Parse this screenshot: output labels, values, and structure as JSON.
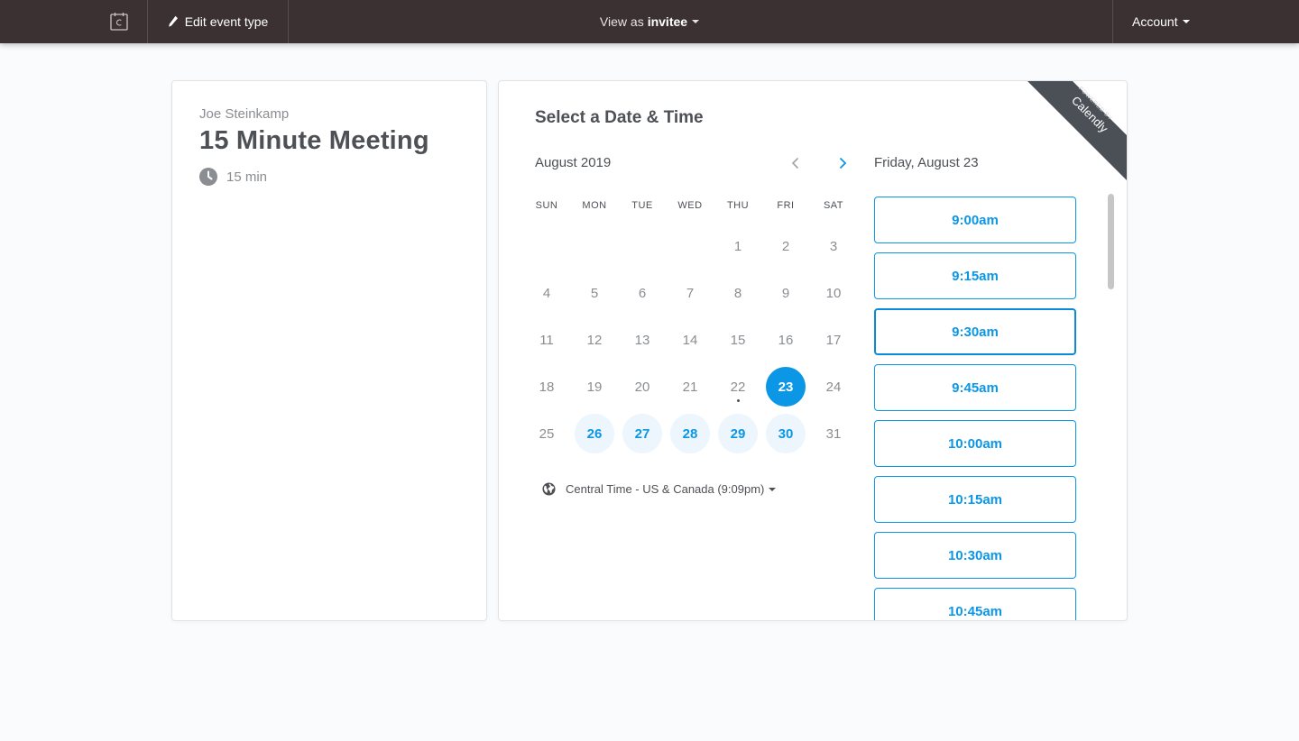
{
  "topbar": {
    "edit_label": "Edit event type",
    "view_prefix": "View as",
    "view_value": "invitee",
    "account_label": "Account",
    "bg_color": "#3b3032"
  },
  "event": {
    "host": "Joe Steinkamp",
    "title": "15 Minute Meeting",
    "duration": "15 min"
  },
  "scheduler": {
    "heading": "Select a Date & Time",
    "month": "August 2019",
    "weekdays": [
      "SUN",
      "MON",
      "TUE",
      "WED",
      "THU",
      "FRI",
      "SAT"
    ],
    "weeks": [
      [
        "",
        "",
        "",
        "",
        "1",
        "2",
        "3"
      ],
      [
        "4",
        "5",
        "6",
        "7",
        "8",
        "9",
        "10"
      ],
      [
        "11",
        "12",
        "13",
        "14",
        "15",
        "16",
        "17"
      ],
      [
        "18",
        "19",
        "20",
        "21",
        "22",
        "23",
        "24"
      ],
      [
        "25",
        "26",
        "27",
        "28",
        "29",
        "30",
        "31"
      ]
    ],
    "available_days": [
      "26",
      "27",
      "28",
      "29",
      "30"
    ],
    "selected_day": "23",
    "today": "22",
    "timezone": "Central Time - US & Canada (9:09pm)",
    "selected_date_label": "Friday, August 23",
    "time_slots": [
      "9:00am",
      "9:15am",
      "9:30am",
      "9:45am",
      "10:00am",
      "10:15am",
      "10:30am",
      "10:45am"
    ],
    "focused_slot": "9:30am",
    "accent_color": "#0b96e6"
  },
  "ribbon": {
    "small": "POWERED BY",
    "brand": "Calendly"
  }
}
